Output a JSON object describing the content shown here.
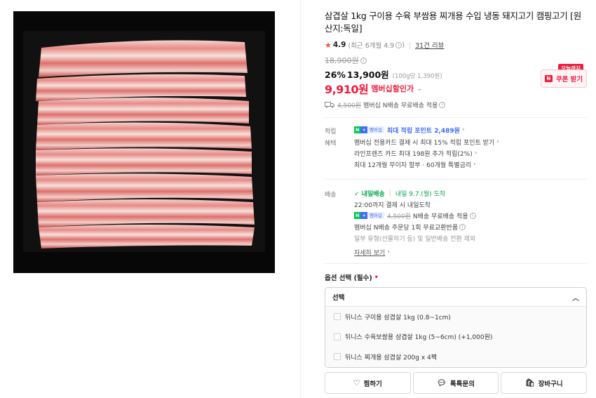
{
  "product": {
    "title": "삼겹살 1kg 구이용 수육 부쌈용 찌개용 수입 냉동 돼지고기 캠핑고기 [원산지:독일]",
    "rating": "4.9",
    "rating_recent": "(최근 6개월 4.9",
    "review_count": "31건 리뷰",
    "original_price": "18,900원",
    "sale_rate": "26%",
    "sale_price": "13,900원",
    "unit_price": "(100g당 1,390원)",
    "member_price": "9,910원",
    "member_price_label": "멤버십할인가",
    "coupon_tag": "오늘까지",
    "coupon_label": "쿠폰 받기",
    "shipping_original": "4,500원",
    "shipping_text": "멤버십 N배송 무료배송 적용"
  },
  "benefits": {
    "points_label": "적립",
    "points_badge": "멤버십",
    "points_text": "최대 적립 포인트 2,489원",
    "benefit_label": "혜택",
    "benefit_lines": [
      "멤버십 전용카드 결제 시 최대 15% 적립 포인트 받기",
      "라인프렌즈 카드 최대 198원 추가 적립(2%)",
      "최대 12개월 무이자 할부 · 60개월 특별금리"
    ]
  },
  "delivery": {
    "label": "배송",
    "type": "내일배송",
    "arrival": "내일 9.7.(월) 도착",
    "cutoff": "22:00까지 결제 시 내일도착",
    "fee_original": "4,500원",
    "fee_text": "N배송 무료배송 적용",
    "return_text": "멤버십 N배송 주문당 1회 무료교환반품",
    "exclusion": "일부 유형(선물하기 등) 및 일반배송 전환 제외",
    "more": "자세히 보기"
  },
  "options": {
    "title": "옵션 선택 (필수)",
    "required_mark": "•",
    "selected": "선택",
    "items": [
      "뒤니스 구이용 삼겹살 1kg (0.8~1cm)",
      "뒤니스 수육보쌈용 삼겹살 1kg (5~6cm) (+1,000원)",
      "뒤니스 찌개용 삼겹살 200g x 4팩"
    ]
  },
  "actions": {
    "wish": "찜하기",
    "chat": "톡톡문의",
    "cart": "장바구니"
  },
  "colors": {
    "accent_red": "#ef1c3d",
    "naver_green": "#03c75a",
    "point_blue": "#3f6df4"
  },
  "icons": [
    "star-icon",
    "info-icon",
    "chevron-down-icon",
    "coupon-icon",
    "truck-icon",
    "chevron-right-icon",
    "chevron-up-icon",
    "checkbox-icon",
    "heart-icon",
    "chat-icon",
    "bag-icon"
  ]
}
